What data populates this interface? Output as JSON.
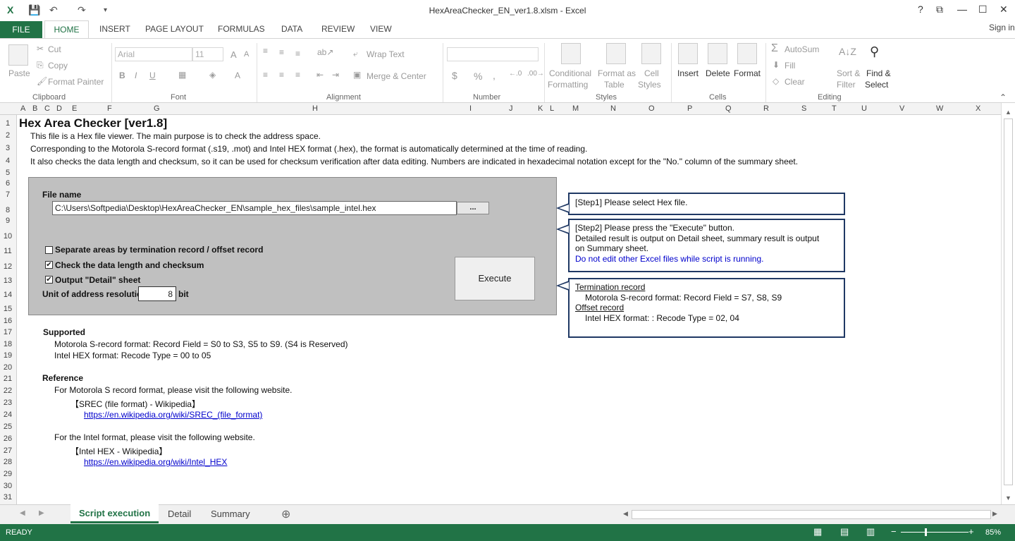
{
  "window": {
    "title": "HexAreaChecker_EN_ver1.8.xlsm - Excel",
    "help": "?",
    "signin": "Sign in"
  },
  "ribbon_tabs": [
    "FILE",
    "HOME",
    "INSERT",
    "PAGE LAYOUT",
    "FORMULAS",
    "DATA",
    "REVIEW",
    "VIEW"
  ],
  "ribbon": {
    "paste": "Paste",
    "cut": "Cut",
    "copy": "Copy",
    "format_painter": "Format Painter",
    "clipboard": "Clipboard",
    "font_name": "Arial",
    "font_size": "11",
    "font_group": "Font",
    "wrap_text": "Wrap Text",
    "merge_center": "Merge & Center",
    "alignment": "Alignment",
    "number": "Number",
    "conditional": "Conditional",
    "formatting": "Formatting",
    "format_as": "Format as",
    "table": "Table",
    "cell": "Cell",
    "styles_btn": "Styles",
    "styles": "Styles",
    "insert": "Insert",
    "delete": "Delete",
    "format": "Format",
    "cells": "Cells",
    "autosum": "AutoSum",
    "fill": "Fill",
    "clear": "Clear",
    "sort": "Sort &",
    "filter": "Filter",
    "find": "Find &",
    "select": "Select",
    "editing": "Editing"
  },
  "columns": [
    "A",
    "B",
    "C",
    "D",
    "E",
    "F",
    "G",
    "H",
    "I",
    "J",
    "K",
    "L",
    "M",
    "N",
    "O",
    "P",
    "Q",
    "R",
    "S",
    "T",
    "U",
    "V",
    "W",
    "X"
  ],
  "rows": [
    "1",
    "2",
    "3",
    "4",
    "5",
    "6",
    "7",
    "8",
    "9",
    "10",
    "11",
    "12",
    "13",
    "14",
    "15",
    "16",
    "17",
    "18",
    "19",
    "20",
    "21",
    "22",
    "23",
    "24",
    "25",
    "26",
    "27",
    "28",
    "29",
    "30",
    "31"
  ],
  "sheet": {
    "heading": "Hex Area Checker  [ver1.8]",
    "line2": "This file is a Hex file viewer. The main purpose is to check the address space.",
    "line3": "Corresponding to the Motorola S-record format (.s19, .mot) and Intel HEX format (.hex), the format is automatically determined at the time of reading.",
    "line4": "It also checks the data length and checksum, so it can be used for checksum verification after data editing. Numbers are indicated in hexadecimal notation except for the \"No.\" column of the summary sheet.",
    "file_name_label": "File name",
    "file_path": "C:\\Users\\Softpedia\\Desktop\\HexAreaChecker_EN\\sample_hex_files\\sample_intel.hex",
    "browse": "...",
    "opt1": "Separate areas by termination record / offset record",
    "opt2": "Check the data length and checksum",
    "opt3": "Output \"Detail\" sheet",
    "unit_label": "Unit of address resolution",
    "unit_value": "8",
    "unit_suffix": "bit",
    "execute": "Execute",
    "step1": "[Step1] Please select Hex file.",
    "step2_a": "[Step2] Please press the \"Execute\" button.",
    "step2_b": "Detailed result is output on Detail sheet, summary result is output",
    "step2_c": "on Summary sheet.",
    "step2_warn": "Do not edit other Excel files while script is running.",
    "term_title": "Termination record",
    "term_text": "Motorola S-record format: Record Field =  S7, S8, S9",
    "offset_title": "Offset record",
    "offset_text": "Intel HEX format: : Recode Type = 02, 04",
    "supported": "Supported",
    "sup1": "Motorola S-record format: Record Field = S0 to S3, S5 to S9. (S4 is Reserved)",
    "sup2": "Intel HEX format: Recode Type = 00 to 05",
    "reference": "Reference",
    "ref1": "For Motorola S record format, please visit the following website.",
    "ref1_title": "【SREC (file format) - Wikipedia】",
    "ref1_link": "https://en.wikipedia.org/wiki/SREC_(file_format)",
    "ref2": "For the Intel format, please visit the following website.",
    "ref2_title": "【Intel HEX - Wikipedia】",
    "ref2_link": "https://en.wikipedia.org/wiki/Intel_HEX"
  },
  "sheet_tabs": [
    "Script execution",
    "Detail",
    "Summary"
  ],
  "status": {
    "ready": "READY",
    "zoom": "85%"
  },
  "colors": {
    "excel_green": "#217346",
    "callout_border": "#1f3864",
    "panel_gray": "#c0c0c0",
    "link_blue": "#0000cc"
  }
}
